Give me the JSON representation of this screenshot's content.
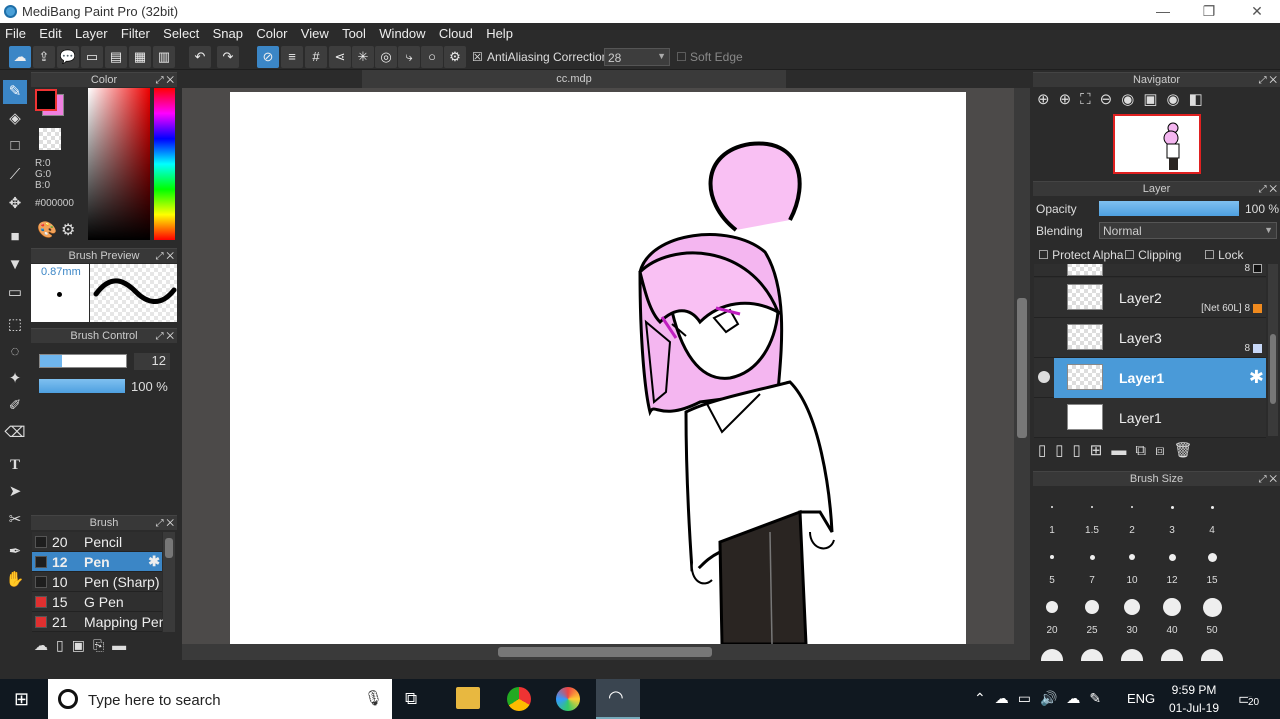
{
  "window": {
    "title": "MediBang Paint Pro (32bit)",
    "minimize": "—",
    "restore": "❐",
    "close": "✕"
  },
  "menu": [
    "File",
    "Edit",
    "Layer",
    "Filter",
    "Select",
    "Snap",
    "Color",
    "View",
    "Tool",
    "Window",
    "Cloud",
    "Help"
  ],
  "toolbar": {
    "antialiasing_label": "AntiAliasing",
    "antialiasing_checked": "☒",
    "correction_label": "Correction",
    "correction_value": "28",
    "soft_edge_label": "Soft Edge",
    "soft_edge_checked": "☐"
  },
  "document": {
    "tab": "cc.mdp"
  },
  "color_panel": {
    "title": "Color",
    "r": "R:0",
    "g": "G:0",
    "b": "B:0",
    "hex": "#000000",
    "main_color": "#000000",
    "sub_color": "#f080e0"
  },
  "brush_preview": {
    "title": "Brush Preview",
    "size": "0.87mm"
  },
  "brush_control": {
    "title": "Brush Control",
    "size_value": "12",
    "opacity_value": "100 %",
    "size_fraction": 0.25,
    "opacity_fraction": 1.0
  },
  "brush_panel": {
    "title": "Brush",
    "items": [
      {
        "num": "20",
        "name": "Pencil",
        "color": "#1e1e1e"
      },
      {
        "num": "12",
        "name": "Pen",
        "color": "#1e1e1e"
      },
      {
        "num": "10",
        "name": "Pen (Sharp)",
        "color": "#1e1e1e"
      },
      {
        "num": "15",
        "name": "G Pen",
        "color": "#e03030"
      },
      {
        "num": "21",
        "name": "Mapping Pen",
        "color": "#e03030"
      }
    ]
  },
  "navigator": {
    "title": "Navigator"
  },
  "layer_panel": {
    "title": "Layer",
    "opacity_label": "Opacity",
    "opacity_value": "100 %",
    "opacity_fraction": 1.0,
    "blending_label": "Blending",
    "blending_value": "Normal",
    "protect_alpha": "Protect Alpha",
    "clipping": "Clipping",
    "lock": "Lock",
    "top_partial_badge": "8",
    "layers": [
      {
        "name": "Layer2",
        "badge": "[Net 60L] 8",
        "badge_color": "#f08a1e"
      },
      {
        "name": "Layer3",
        "badge": "8",
        "badge_color": "#c8d8f8"
      },
      {
        "name": "Layer1",
        "badge": "",
        "badge_color": ""
      },
      {
        "name": "Layer1",
        "badge": "",
        "badge_color": ""
      }
    ]
  },
  "brush_size_panel": {
    "title": "Brush Size",
    "sizes": [
      "1",
      "1.5",
      "2",
      "3",
      "4",
      "5",
      "7",
      "10",
      "12",
      "15",
      "20",
      "25",
      "30",
      "40",
      "50"
    ]
  },
  "taskbar": {
    "search_placeholder": "Type here to search",
    "language": "ENG",
    "time": "9:59 PM",
    "date": "01-Jul-19",
    "notifications": "20"
  }
}
